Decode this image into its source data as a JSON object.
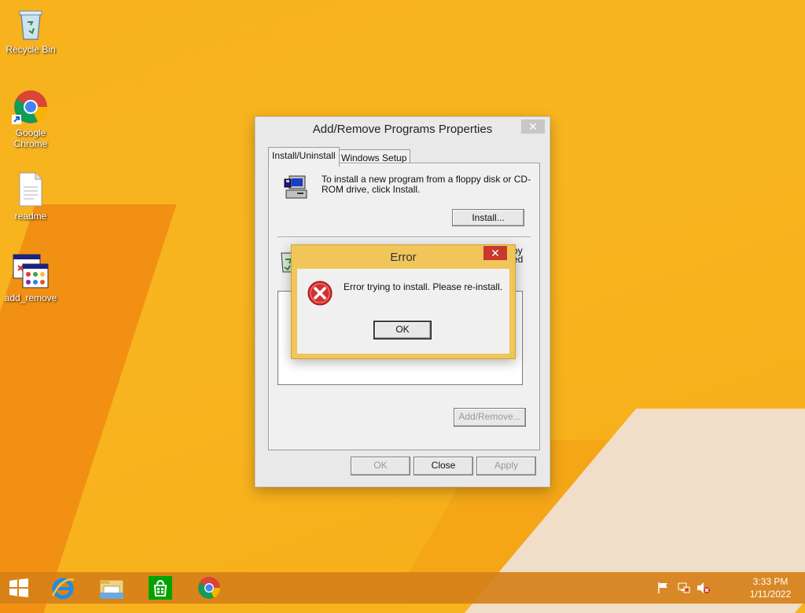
{
  "desktop": {
    "icons": [
      {
        "label": "Recycle Bin",
        "icon": "recycle-bin-icon"
      },
      {
        "label": "Google Chrome",
        "icon": "chrome-icon"
      },
      {
        "label": "readme",
        "icon": "text-file-icon"
      },
      {
        "label": "add_remove",
        "icon": "add-remove-programs-icon"
      }
    ]
  },
  "properties_window": {
    "title": "Add/Remove Programs Properties",
    "close_glyph": "✕",
    "tabs": [
      {
        "label": "Install/Uninstall",
        "active": true
      },
      {
        "label": "Windows Setup",
        "active": false
      }
    ],
    "install_text": "To install a new program from a floppy disk or CD-ROM drive, click Install.",
    "install_button": "Install...",
    "remove_text_partial_1": "oy",
    "remove_text_partial_2": "ed",
    "add_remove_button": "Add/Remove...",
    "ok_button": "OK",
    "close_button": "Close",
    "apply_button": "Apply"
  },
  "error_dialog": {
    "title": "Error",
    "close_glyph": "✕",
    "message": "Error trying to install. Please re-install.",
    "ok_button": "OK",
    "icon": "error-icon"
  },
  "taskbar": {
    "items": [
      "start-icon",
      "internet-explorer-icon",
      "file-explorer-icon",
      "store-icon",
      "chrome-icon"
    ],
    "tray_icons": [
      "flag-icon",
      "network-icon",
      "volume-muted-icon"
    ],
    "time": "3:33 PM",
    "date": "1/11/2022"
  },
  "colors": {
    "desktop_bg": "#f7b21e",
    "taskbar": "#d68018",
    "error_frame": "#f0c65a",
    "error_close": "#c7392b"
  }
}
